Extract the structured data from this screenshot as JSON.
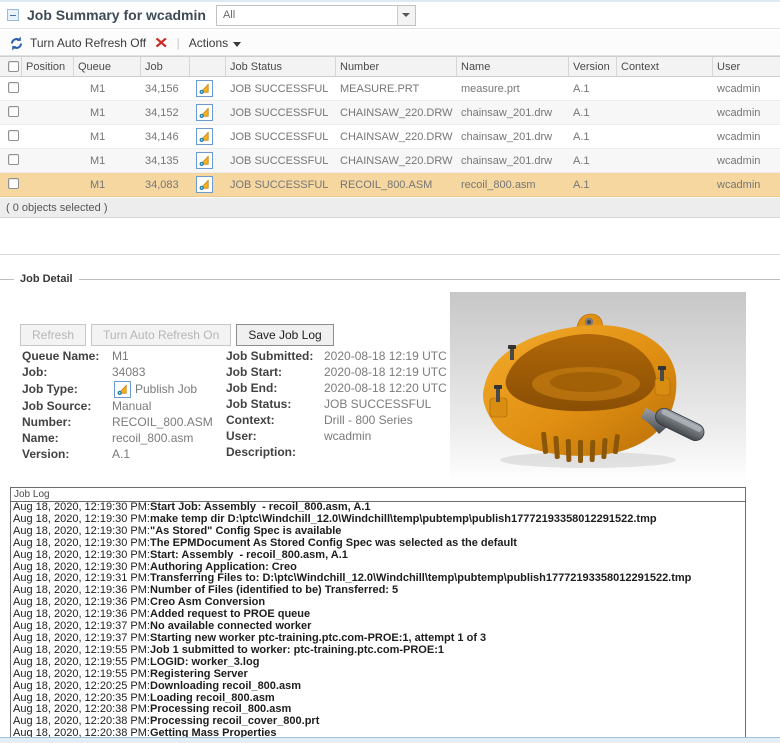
{
  "header": {
    "title": "Job Summary for wcadmin",
    "filter_value": "All"
  },
  "toolbar": {
    "auto_refresh_label": "Turn Auto Refresh Off",
    "actions_label": "Actions"
  },
  "table": {
    "columns": {
      "position": "Position",
      "queue": "Queue",
      "job": "Job",
      "job_status": "Job Status",
      "number": "Number",
      "name": "Name",
      "version": "Version",
      "context": "Context",
      "user": "User"
    },
    "rows": [
      {
        "position": "",
        "queue": "M1",
        "job": "34,156",
        "job_status": "JOB SUCCESSFUL",
        "number": "MEASURE.PRT",
        "name": "measure.prt",
        "version": "A.1",
        "context": "",
        "user": "wcadmin",
        "selected": false
      },
      {
        "position": "",
        "queue": "M1",
        "job": "34,152",
        "job_status": "JOB SUCCESSFUL",
        "number": "CHAINSAW_220.DRW",
        "name": "chainsaw_201.drw",
        "version": "A.1",
        "context": "",
        "user": "wcadmin",
        "selected": false
      },
      {
        "position": "",
        "queue": "M1",
        "job": "34,146",
        "job_status": "JOB SUCCESSFUL",
        "number": "CHAINSAW_220.DRW",
        "name": "chainsaw_201.drw",
        "version": "A.1",
        "context": "",
        "user": "wcadmin",
        "selected": false
      },
      {
        "position": "",
        "queue": "M1",
        "job": "34,135",
        "job_status": "JOB SUCCESSFUL",
        "number": "CHAINSAW_220.DRW",
        "name": "chainsaw_201.drw",
        "version": "A.1",
        "context": "",
        "user": "wcadmin",
        "selected": false
      },
      {
        "position": "",
        "queue": "M1",
        "job": "34,083",
        "job_status": "JOB SUCCESSFUL",
        "number": "RECOIL_800.ASM",
        "name": "recoil_800.asm",
        "version": "A.1",
        "context": "",
        "user": "wcadmin",
        "selected": true
      }
    ],
    "selection_status": "( 0 objects selected )"
  },
  "job_detail": {
    "legend": "Job Detail",
    "buttons": {
      "refresh": "Refresh",
      "auto_refresh_on": "Turn Auto Refresh On",
      "save_job_log": "Save Job Log"
    },
    "fields_left": [
      {
        "label": "Queue Name:",
        "value": "M1"
      },
      {
        "label": "Job:",
        "value": "34083"
      },
      {
        "label": "Job Type:",
        "value": "Publish Job"
      },
      {
        "label": "Job Source:",
        "value": "Manual"
      },
      {
        "label": "Number:",
        "value": "RECOIL_800.ASM"
      },
      {
        "label": "Name:",
        "value": "recoil_800.asm"
      },
      {
        "label": "Version:",
        "value": "A.1"
      }
    ],
    "fields_right": [
      {
        "label": "Job Submitted:",
        "value": "2020-08-18 12:19 UTC"
      },
      {
        "label": "Job Start:",
        "value": "2020-08-18 12:19 UTC"
      },
      {
        "label": "Job End:",
        "value": "2020-08-18 12:20 UTC"
      },
      {
        "label": "Job Status:",
        "value": "JOB SUCCESSFUL"
      },
      {
        "label": "Context:",
        "value": "Drill - 800 Series"
      },
      {
        "label": "User:",
        "value": "wcadmin"
      },
      {
        "label": "Description:",
        "value": ""
      }
    ]
  },
  "job_log": {
    "header": "Job Log",
    "entries": [
      {
        "time": "Aug 18, 2020, 12:19:30 PM:",
        "message": "Start Job: Assembly  - recoil_800.asm, A.1"
      },
      {
        "time": "Aug 18, 2020, 12:19:30 PM:",
        "message": "make temp dir D:\\ptc\\Windchill_12.0\\Windchill\\temp\\pubtemp\\publish17772193358012291522.tmp"
      },
      {
        "time": "Aug 18, 2020, 12:19:30 PM:",
        "message": "\"As Stored\" Config Spec is available"
      },
      {
        "time": "Aug 18, 2020, 12:19:30 PM:",
        "message": "The EPMDocument As Stored Config Spec was selected as the default"
      },
      {
        "time": "Aug 18, 2020, 12:19:30 PM:",
        "message": "Start: Assembly  - recoil_800.asm, A.1"
      },
      {
        "time": "Aug 18, 2020, 12:19:30 PM:",
        "message": "Authoring Application: Creo"
      },
      {
        "time": "Aug 18, 2020, 12:19:31 PM:",
        "message": "Transferring Files to: D:\\ptc\\Windchill_12.0\\Windchill\\temp\\pubtemp\\publish17772193358012291522.tmp"
      },
      {
        "time": "Aug 18, 2020, 12:19:36 PM:",
        "message": "Number of Files (identified to be) Transferred: 5"
      },
      {
        "time": "Aug 18, 2020, 12:19:36 PM:",
        "message": "Creo Asm Conversion"
      },
      {
        "time": "Aug 18, 2020, 12:19:36 PM:",
        "message": "Added request to PROE queue"
      },
      {
        "time": "Aug 18, 2020, 12:19:37 PM:",
        "message": "No available connected worker"
      },
      {
        "time": "Aug 18, 2020, 12:19:37 PM:",
        "message": "Starting new worker ptc-training.ptc.com-PROE:1, attempt 1 of 3"
      },
      {
        "time": "Aug 18, 2020, 12:19:55 PM:",
        "message": "Job 1 submitted to worker: ptc-training.ptc.com-PROE:1"
      },
      {
        "time": "Aug 18, 2020, 12:19:55 PM:",
        "message": "LOGID: worker_3.log"
      },
      {
        "time": "Aug 18, 2020, 12:19:55 PM:",
        "message": "Registering Server"
      },
      {
        "time": "Aug 18, 2020, 12:20:25 PM:",
        "message": "Downloading recoil_800.asm"
      },
      {
        "time": "Aug 18, 2020, 12:20:35 PM:",
        "message": "Loading recoil_800.asm"
      },
      {
        "time": "Aug 18, 2020, 12:20:38 PM:",
        "message": "Processing recoil_800.asm"
      },
      {
        "time": "Aug 18, 2020, 12:20:38 PM:",
        "message": "Processing recoil_cover_800.prt"
      },
      {
        "time": "Aug 18, 2020, 12:20:38 PM:",
        "message": "Getting Mass Properties"
      }
    ]
  },
  "icons": {
    "collapse": "minus-icon",
    "refresh": "refresh-icon",
    "remove": "red-x-icon",
    "dropdown": "chevron-down-icon",
    "publish_job": "publish-job-icon"
  },
  "colors": {
    "selected_row": "#f6d7a0",
    "accent_blue": "#2a5db0",
    "error_red": "#cd2a26",
    "status_bar_bg": "#ededed",
    "model_orange": "#e08f12"
  }
}
